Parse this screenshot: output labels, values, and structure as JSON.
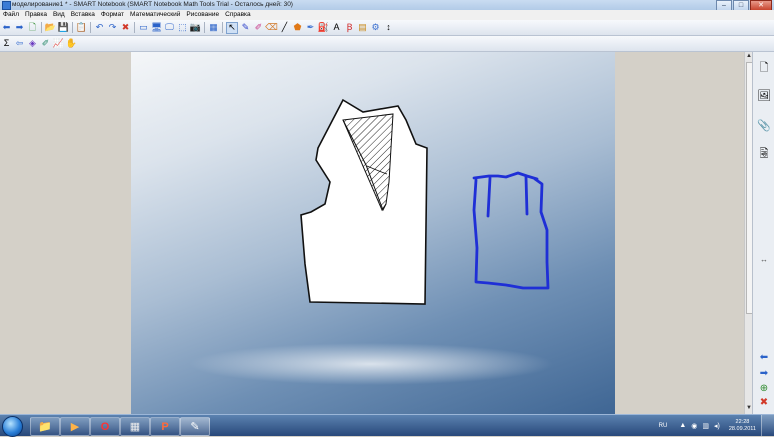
{
  "window": {
    "title": "моделирование1 * - SMART Notebook (SMART Notebook Math Tools Trial - Осталось дней: 30)",
    "minimize": "–",
    "maximize": "□",
    "close": "✕"
  },
  "menu": [
    "Файл",
    "Правка",
    "Вид",
    "Вставка",
    "Формат",
    "Математический",
    "Рисование",
    "Справка"
  ],
  "toolbar1": [
    {
      "name": "back-icon",
      "glyph": "⬅"
    },
    {
      "name": "forward-icon",
      "glyph": "➡"
    },
    {
      "name": "add-page-icon",
      "glyph": "🗋"
    },
    {
      "name": "open-icon",
      "glyph": "📂"
    },
    {
      "name": "save-icon",
      "glyph": "💾"
    },
    {
      "name": "paste-icon",
      "glyph": "📋"
    },
    {
      "name": "undo-icon",
      "glyph": "↶"
    },
    {
      "name": "redo-icon",
      "glyph": "↷"
    },
    {
      "name": "delete-icon",
      "glyph": "✖"
    },
    {
      "name": "screen-shade-icon",
      "glyph": "▭"
    },
    {
      "name": "full-screen-icon",
      "glyph": "🖥"
    },
    {
      "name": "dual-page-icon",
      "glyph": "🖵"
    },
    {
      "name": "screen-capture-icon",
      "glyph": "⬚"
    },
    {
      "name": "document-camera-icon",
      "glyph": "📷"
    },
    {
      "name": "insert-table-icon",
      "glyph": "▦"
    },
    {
      "name": "select-icon",
      "glyph": "↖"
    },
    {
      "name": "pen-icon",
      "glyph": "✎"
    },
    {
      "name": "creative-pen-icon",
      "glyph": "✐"
    },
    {
      "name": "eraser-icon",
      "glyph": "⌫"
    },
    {
      "name": "line-icon",
      "glyph": "╱"
    },
    {
      "name": "shapes-icon",
      "glyph": "⬟"
    },
    {
      "name": "magic-pen-icon",
      "glyph": "✒"
    },
    {
      "name": "fill-icon",
      "glyph": "⛽"
    },
    {
      "name": "text-icon",
      "glyph": "A"
    },
    {
      "name": "properties-icon",
      "glyph": "Ꞵ"
    },
    {
      "name": "fill-color-icon",
      "glyph": "▤"
    },
    {
      "name": "measure-icon",
      "glyph": "⚙"
    },
    {
      "name": "move-toolbar-icon",
      "glyph": "↕"
    }
  ],
  "toolbar2": [
    {
      "name": "sigma-icon",
      "glyph": "Σ"
    },
    {
      "name": "arrow-tool-icon",
      "glyph": "⇦"
    },
    {
      "name": "math-tool-icon",
      "glyph": "◈"
    },
    {
      "name": "graph-tool-icon",
      "glyph": "✐"
    },
    {
      "name": "chart-tool-icon",
      "glyph": "📈"
    },
    {
      "name": "hand-tool-icon",
      "glyph": "✋"
    }
  ],
  "side_tabs": [
    {
      "name": "page-sorter-tab-icon",
      "glyph": "🗋"
    },
    {
      "name": "gallery-tab-icon",
      "glyph": "🖼"
    },
    {
      "name": "attachments-tab-icon",
      "glyph": "📎"
    },
    {
      "name": "properties-tab-icon",
      "glyph": "🗟"
    }
  ],
  "side_collapse": "↔",
  "side_nav": {
    "back": "⬅",
    "forward": "➡",
    "add": "⊕",
    "delete": "✖"
  },
  "colors": {
    "ink_blue": "#1f2fd6",
    "title_bg": "#bcd2ec",
    "taskbar_bg": "#2f5688"
  },
  "taskbar": {
    "apps": [
      {
        "name": "explorer-taskbar-icon",
        "glyph": "📁"
      },
      {
        "name": "media-player-taskbar-icon",
        "glyph": "▶"
      },
      {
        "name": "opera-taskbar-icon",
        "glyph": "O"
      },
      {
        "name": "calculator-taskbar-icon",
        "glyph": "▦"
      },
      {
        "name": "powerpoint-taskbar-icon",
        "glyph": "P"
      },
      {
        "name": "notebook-taskbar-icon",
        "glyph": "✎"
      }
    ],
    "language": "RU",
    "time": "22:28",
    "date": "28.09.2011"
  }
}
